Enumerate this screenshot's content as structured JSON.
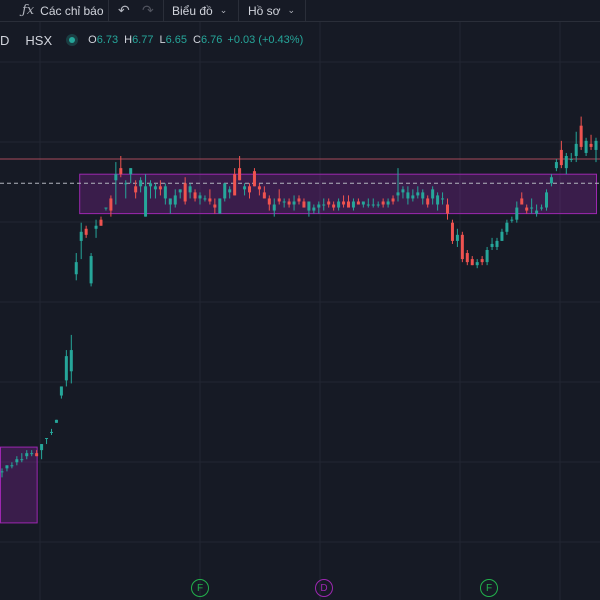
{
  "toolbar": {
    "indicators_label": "Các chỉ báo",
    "chart_label": "Biểu đồ",
    "profile_label": "Hồ sơ"
  },
  "legend": {
    "symbol_prefix": "D",
    "exchange": "HSX",
    "open_label": "O",
    "open": "6.73",
    "high_label": "H",
    "high": "6.77",
    "low_label": "L",
    "low": "6.65",
    "close_label": "C",
    "close": "6.76",
    "change": "+0.03 (+0.43%)"
  },
  "markers": [
    {
      "label": "F",
      "color": "#22b14c"
    },
    {
      "label": "D",
      "color": "#9c27b0"
    },
    {
      "label": "F",
      "color": "#22b14c"
    }
  ],
  "colors": {
    "background": "#161a25",
    "up": "#26a69a",
    "down": "#ef5350",
    "zone_border": "#9c27b0",
    "zone_fill": "rgba(156,39,176,0.28)"
  },
  "chart_data": {
    "type": "candlestick",
    "ylim": [
      5.6,
      7.15
    ],
    "zones": [
      {
        "x_start": 0,
        "x_end": 7,
        "y_low": 5.63,
        "y_high": 5.88
      },
      {
        "x_start": 16,
        "x_end": 120,
        "y_low": 6.65,
        "y_high": 6.78
      }
    ],
    "reference_lines": [
      {
        "y": 6.83,
        "style": "solid",
        "color": "#a84a5a"
      },
      {
        "y": 6.75,
        "style": "dashed",
        "color": "#b2b5be"
      }
    ],
    "candles": [
      [
        5.8,
        5.81,
        5.78,
        5.8
      ],
      [
        5.81,
        5.82,
        5.8,
        5.82
      ],
      [
        5.82,
        5.83,
        5.81,
        5.82
      ],
      [
        5.83,
        5.85,
        5.82,
        5.84
      ],
      [
        5.84,
        5.86,
        5.83,
        5.84
      ],
      [
        5.85,
        5.87,
        5.84,
        5.86
      ],
      [
        5.86,
        5.87,
        5.85,
        5.86
      ],
      [
        5.86,
        5.87,
        5.85,
        5.85
      ],
      [
        5.87,
        5.89,
        5.84,
        5.89
      ],
      [
        5.91,
        5.91,
        5.89,
        5.91
      ],
      [
        5.93,
        5.94,
        5.92,
        5.93
      ],
      [
        5.96,
        5.97,
        5.96,
        5.97
      ],
      [
        6.05,
        6.08,
        6.04,
        6.08
      ],
      [
        6.1,
        6.2,
        6.08,
        6.18
      ],
      [
        6.13,
        6.25,
        6.09,
        6.2
      ],
      [
        6.45,
        6.52,
        6.43,
        6.49
      ],
      [
        6.56,
        6.62,
        6.5,
        6.59
      ],
      [
        6.6,
        6.61,
        6.57,
        6.58
      ],
      [
        6.42,
        6.52,
        6.41,
        6.51
      ],
      [
        6.6,
        6.63,
        6.57,
        6.61
      ],
      [
        6.63,
        6.64,
        6.61,
        6.61
      ],
      [
        6.67,
        6.67,
        6.66,
        6.67
      ],
      [
        6.7,
        6.71,
        6.64,
        6.66
      ],
      [
        6.76,
        6.82,
        6.68,
        6.78
      ],
      [
        6.8,
        6.84,
        6.77,
        6.78
      ],
      [
        6.75,
        6.76,
        6.7,
        6.75
      ],
      [
        6.78,
        6.8,
        6.75,
        6.8
      ],
      [
        6.74,
        6.76,
        6.7,
        6.72
      ],
      [
        6.74,
        6.77,
        6.72,
        6.76
      ],
      [
        6.64,
        6.78,
        6.64,
        6.74
      ],
      [
        6.74,
        6.76,
        6.7,
        6.75
      ],
      [
        6.73,
        6.75,
        6.7,
        6.74
      ],
      [
        6.74,
        6.76,
        6.71,
        6.73
      ],
      [
        6.7,
        6.75,
        6.68,
        6.74
      ],
      [
        6.68,
        6.7,
        6.65,
        6.7
      ],
      [
        6.68,
        6.73,
        6.67,
        6.71
      ],
      [
        6.72,
        6.73,
        6.7,
        6.73
      ],
      [
        6.75,
        6.77,
        6.68,
        6.69
      ],
      [
        6.72,
        6.75,
        6.7,
        6.74
      ],
      [
        6.72,
        6.73,
        6.69,
        6.7
      ],
      [
        6.7,
        6.72,
        6.68,
        6.71
      ],
      [
        6.7,
        6.71,
        6.69,
        6.7
      ],
      [
        6.7,
        6.73,
        6.68,
        6.69
      ],
      [
        6.68,
        6.7,
        6.65,
        6.67
      ],
      [
        6.65,
        6.7,
        6.65,
        6.7
      ],
      [
        6.7,
        6.75,
        6.69,
        6.75
      ],
      [
        6.72,
        6.74,
        6.7,
        6.73
      ],
      [
        6.78,
        6.8,
        6.71,
        6.71
      ],
      [
        6.8,
        6.84,
        6.76,
        6.76
      ],
      [
        6.73,
        6.75,
        6.71,
        6.74
      ],
      [
        6.74,
        6.75,
        6.7,
        6.72
      ],
      [
        6.79,
        6.8,
        6.74,
        6.74
      ],
      [
        6.74,
        6.75,
        6.71,
        6.73
      ],
      [
        6.72,
        6.74,
        6.7,
        6.7
      ],
      [
        6.7,
        6.71,
        6.66,
        6.68
      ],
      [
        6.66,
        6.7,
        6.64,
        6.68
      ],
      [
        6.7,
        6.73,
        6.68,
        6.69
      ],
      [
        6.69,
        6.7,
        6.67,
        6.69
      ],
      [
        6.69,
        6.7,
        6.67,
        6.68
      ],
      [
        6.68,
        6.71,
        6.66,
        6.69
      ],
      [
        6.7,
        6.71,
        6.68,
        6.69
      ],
      [
        6.69,
        6.7,
        6.67,
        6.67
      ],
      [
        6.66,
        6.69,
        6.64,
        6.69
      ],
      [
        6.66,
        6.68,
        6.65,
        6.67
      ],
      [
        6.67,
        6.69,
        6.65,
        6.68
      ],
      [
        6.68,
        6.7,
        6.66,
        6.68
      ],
      [
        6.69,
        6.7,
        6.67,
        6.68
      ],
      [
        6.68,
        6.69,
        6.66,
        6.67
      ],
      [
        6.67,
        6.7,
        6.66,
        6.69
      ],
      [
        6.69,
        6.71,
        6.67,
        6.68
      ],
      [
        6.69,
        6.71,
        6.67,
        6.67
      ],
      [
        6.67,
        6.7,
        6.66,
        6.69
      ],
      [
        6.69,
        6.7,
        6.68,
        6.68
      ],
      [
        6.68,
        6.69,
        6.67,
        6.69
      ],
      [
        6.68,
        6.7,
        6.67,
        6.68
      ],
      [
        6.68,
        6.7,
        6.67,
        6.68
      ],
      [
        6.68,
        6.69,
        6.67,
        6.68
      ],
      [
        6.69,
        6.7,
        6.67,
        6.68
      ],
      [
        6.68,
        6.7,
        6.67,
        6.69
      ],
      [
        6.7,
        6.71,
        6.68,
        6.69
      ],
      [
        6.71,
        6.8,
        6.69,
        6.72
      ],
      [
        6.72,
        6.74,
        6.7,
        6.73
      ],
      [
        6.7,
        6.74,
        6.68,
        6.72
      ],
      [
        6.7,
        6.73,
        6.69,
        6.71
      ],
      [
        6.71,
        6.74,
        6.7,
        6.72
      ],
      [
        6.7,
        6.73,
        6.68,
        6.72
      ],
      [
        6.7,
        6.71,
        6.67,
        6.68
      ],
      [
        6.7,
        6.74,
        6.68,
        6.73
      ],
      [
        6.68,
        6.72,
        6.66,
        6.71
      ],
      [
        6.7,
        6.72,
        6.68,
        6.7
      ],
      [
        6.68,
        6.7,
        6.63,
        6.65
      ],
      [
        6.62,
        6.63,
        6.55,
        6.56
      ],
      [
        6.56,
        6.6,
        6.54,
        6.58
      ],
      [
        6.58,
        6.59,
        6.49,
        6.5
      ],
      [
        6.52,
        6.53,
        6.48,
        6.49
      ],
      [
        6.5,
        6.51,
        6.48,
        6.48
      ],
      [
        6.48,
        6.5,
        6.47,
        6.49
      ],
      [
        6.5,
        6.51,
        6.48,
        6.49
      ],
      [
        6.49,
        6.54,
        6.48,
        6.53
      ],
      [
        6.54,
        6.57,
        6.53,
        6.55
      ],
      [
        6.54,
        6.57,
        6.53,
        6.56
      ],
      [
        6.56,
        6.6,
        6.56,
        6.59
      ],
      [
        6.59,
        6.63,
        6.58,
        6.62
      ],
      [
        6.63,
        6.64,
        6.62,
        6.63
      ],
      [
        6.63,
        6.69,
        6.62,
        6.67
      ],
      [
        6.7,
        6.72,
        6.68,
        6.68
      ],
      [
        6.67,
        6.68,
        6.65,
        6.66
      ],
      [
        6.67,
        6.7,
        6.65,
        6.67
      ],
      [
        6.65,
        6.68,
        6.64,
        6.66
      ],
      [
        6.67,
        6.68,
        6.66,
        6.67
      ],
      [
        6.67,
        6.73,
        6.66,
        6.72
      ],
      [
        6.75,
        6.78,
        6.74,
        6.77
      ],
      [
        6.8,
        6.83,
        6.79,
        6.82
      ],
      [
        6.86,
        6.89,
        6.8,
        6.81
      ],
      [
        6.8,
        6.85,
        6.78,
        6.84
      ],
      [
        6.83,
        6.85,
        6.82,
        6.83
      ],
      [
        6.84,
        6.92,
        6.82,
        6.88
      ],
      [
        6.94,
        6.97,
        6.86,
        6.87
      ],
      [
        6.85,
        6.9,
        6.84,
        6.89
      ],
      [
        6.88,
        6.91,
        6.86,
        6.87
      ],
      [
        6.86,
        6.9,
        6.82,
        6.89
      ]
    ]
  }
}
